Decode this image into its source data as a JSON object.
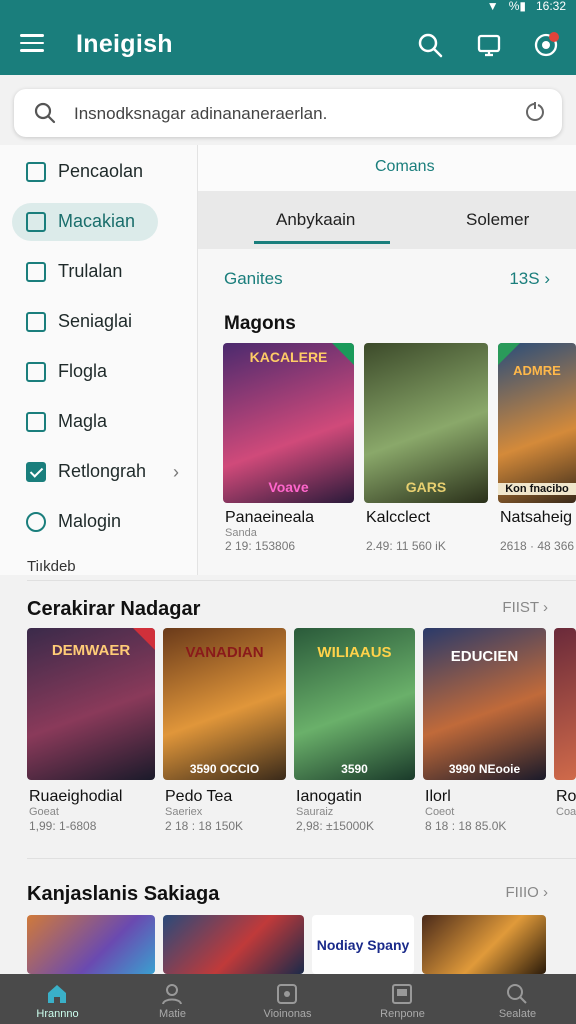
{
  "status_bar": {
    "time": "16:32"
  },
  "app_bar": {
    "title": "Ineigish",
    "icons": [
      "menu-icon",
      "search-icon",
      "cast-icon",
      "notification-icon"
    ]
  },
  "search": {
    "placeholder": "Insnodksnagar adinananeraerlan."
  },
  "drawer": {
    "items": [
      {
        "label": "Pencaolan",
        "icon": "open-box-icon",
        "active": false
      },
      {
        "label": "Macakian",
        "icon": "edit-box-icon",
        "active": true
      },
      {
        "label": "Trulalan",
        "icon": "pencil-box-icon",
        "active": false
      },
      {
        "label": "Seniaglai",
        "icon": "dot-box-icon",
        "active": false
      },
      {
        "label": "Flogla",
        "icon": "square-icon",
        "active": false
      },
      {
        "label": "Magla",
        "icon": "square-icon",
        "active": false
      },
      {
        "label": "Retlongrah",
        "icon": "checkbox-icon",
        "active": false,
        "has_submenu": true
      },
      {
        "label": "Malogin",
        "icon": "verified-icon",
        "active": false
      }
    ],
    "partial_item": "Tiıkdeb"
  },
  "right_panel": {
    "header": "Comans",
    "tabs": [
      {
        "label": "Anbykaain",
        "active": true
      },
      {
        "label": "Solemer",
        "active": false
      }
    ],
    "genres_label": "Ganites",
    "genres_count": "13S",
    "section_title": "Magons",
    "cards": [
      {
        "title": "Panaeineala",
        "sub": "Sanda",
        "meta": "2 19: 153806",
        "art_text": "Voave",
        "banner": "KACALERE",
        "colors": [
          "#4b2a6e",
          "#d04a7a"
        ]
      },
      {
        "title": "Kalcclect",
        "sub": "",
        "meta": "2.49: 11 560 iK",
        "art_text": "GARS",
        "banner": "",
        "colors": [
          "#3c4a2a",
          "#8aa86a"
        ]
      },
      {
        "title": "Natsaheig",
        "sub": "",
        "meta": "2618 · 48 366",
        "art_text": "Kon fnacibo",
        "banner": "ADMRE",
        "colors": [
          "#2a4d7a",
          "#d48a3a"
        ]
      }
    ]
  },
  "section2": {
    "title": "Cerakirar Nadagar",
    "more": "FIIST",
    "cards": [
      {
        "title": "Ruaeighodial",
        "sub": "Goeat",
        "meta": "1,99: 1-6808",
        "banner": "DEMWAER",
        "badge": "",
        "colors": [
          "#3a2a4a",
          "#8a3a5a"
        ]
      },
      {
        "title": "Pedo Tea",
        "sub": "Saeriex",
        "meta": "2 18 : 18 150K",
        "banner": "VANADIAN",
        "badge": "3590 OCCIO",
        "colors": [
          "#6a3a1a",
          "#e0963a"
        ]
      },
      {
        "title": "Ianogatin",
        "sub": "Sauraiz",
        "meta": "2,98: ±15000K",
        "banner": "WILIAAUS",
        "badge": "3590",
        "colors": [
          "#2a5a3a",
          "#6ab06a"
        ]
      },
      {
        "title": "Ilorl",
        "sub": "Coeot",
        "meta": "8 18 : 18 85.0K",
        "banner": "EDUCIEN",
        "badge": "3990 NEooie",
        "colors": [
          "#2a3a6a",
          "#c06a3a"
        ]
      },
      {
        "title": "Ro",
        "sub": "Coate",
        "meta": "",
        "banner": "",
        "badge": "",
        "colors": [
          "#6a2a3a",
          "#d06a4a"
        ]
      }
    ]
  },
  "section3": {
    "title": "Kanjaslanis Sakiaga",
    "more": "FIIIO",
    "cards": [
      {
        "banner": "",
        "colors": [
          "#d07a3a",
          "#6a4ab0"
        ]
      },
      {
        "banner": "",
        "colors": [
          "#2a4a7a",
          "#c03a3a"
        ]
      },
      {
        "banner": "Nodiay Spany",
        "colors": [
          "#ffffff",
          "#ffffff"
        ]
      },
      {
        "banner": "",
        "colors": [
          "#4a2a1a",
          "#e09a3a"
        ]
      }
    ]
  },
  "bottom_nav": {
    "items": [
      {
        "label": "Hrannno",
        "icon": "home-icon",
        "active": true
      },
      {
        "label": "Matie",
        "icon": "person-icon",
        "active": false
      },
      {
        "label": "Vioinonas",
        "icon": "photo-icon",
        "active": false
      },
      {
        "label": "Renpone",
        "icon": "library-icon",
        "active": false
      },
      {
        "label": "Sealate",
        "icon": "search-icon",
        "active": false
      }
    ]
  },
  "colors": {
    "primary": "#1a7e7c",
    "nav": "#4a4a4a"
  }
}
